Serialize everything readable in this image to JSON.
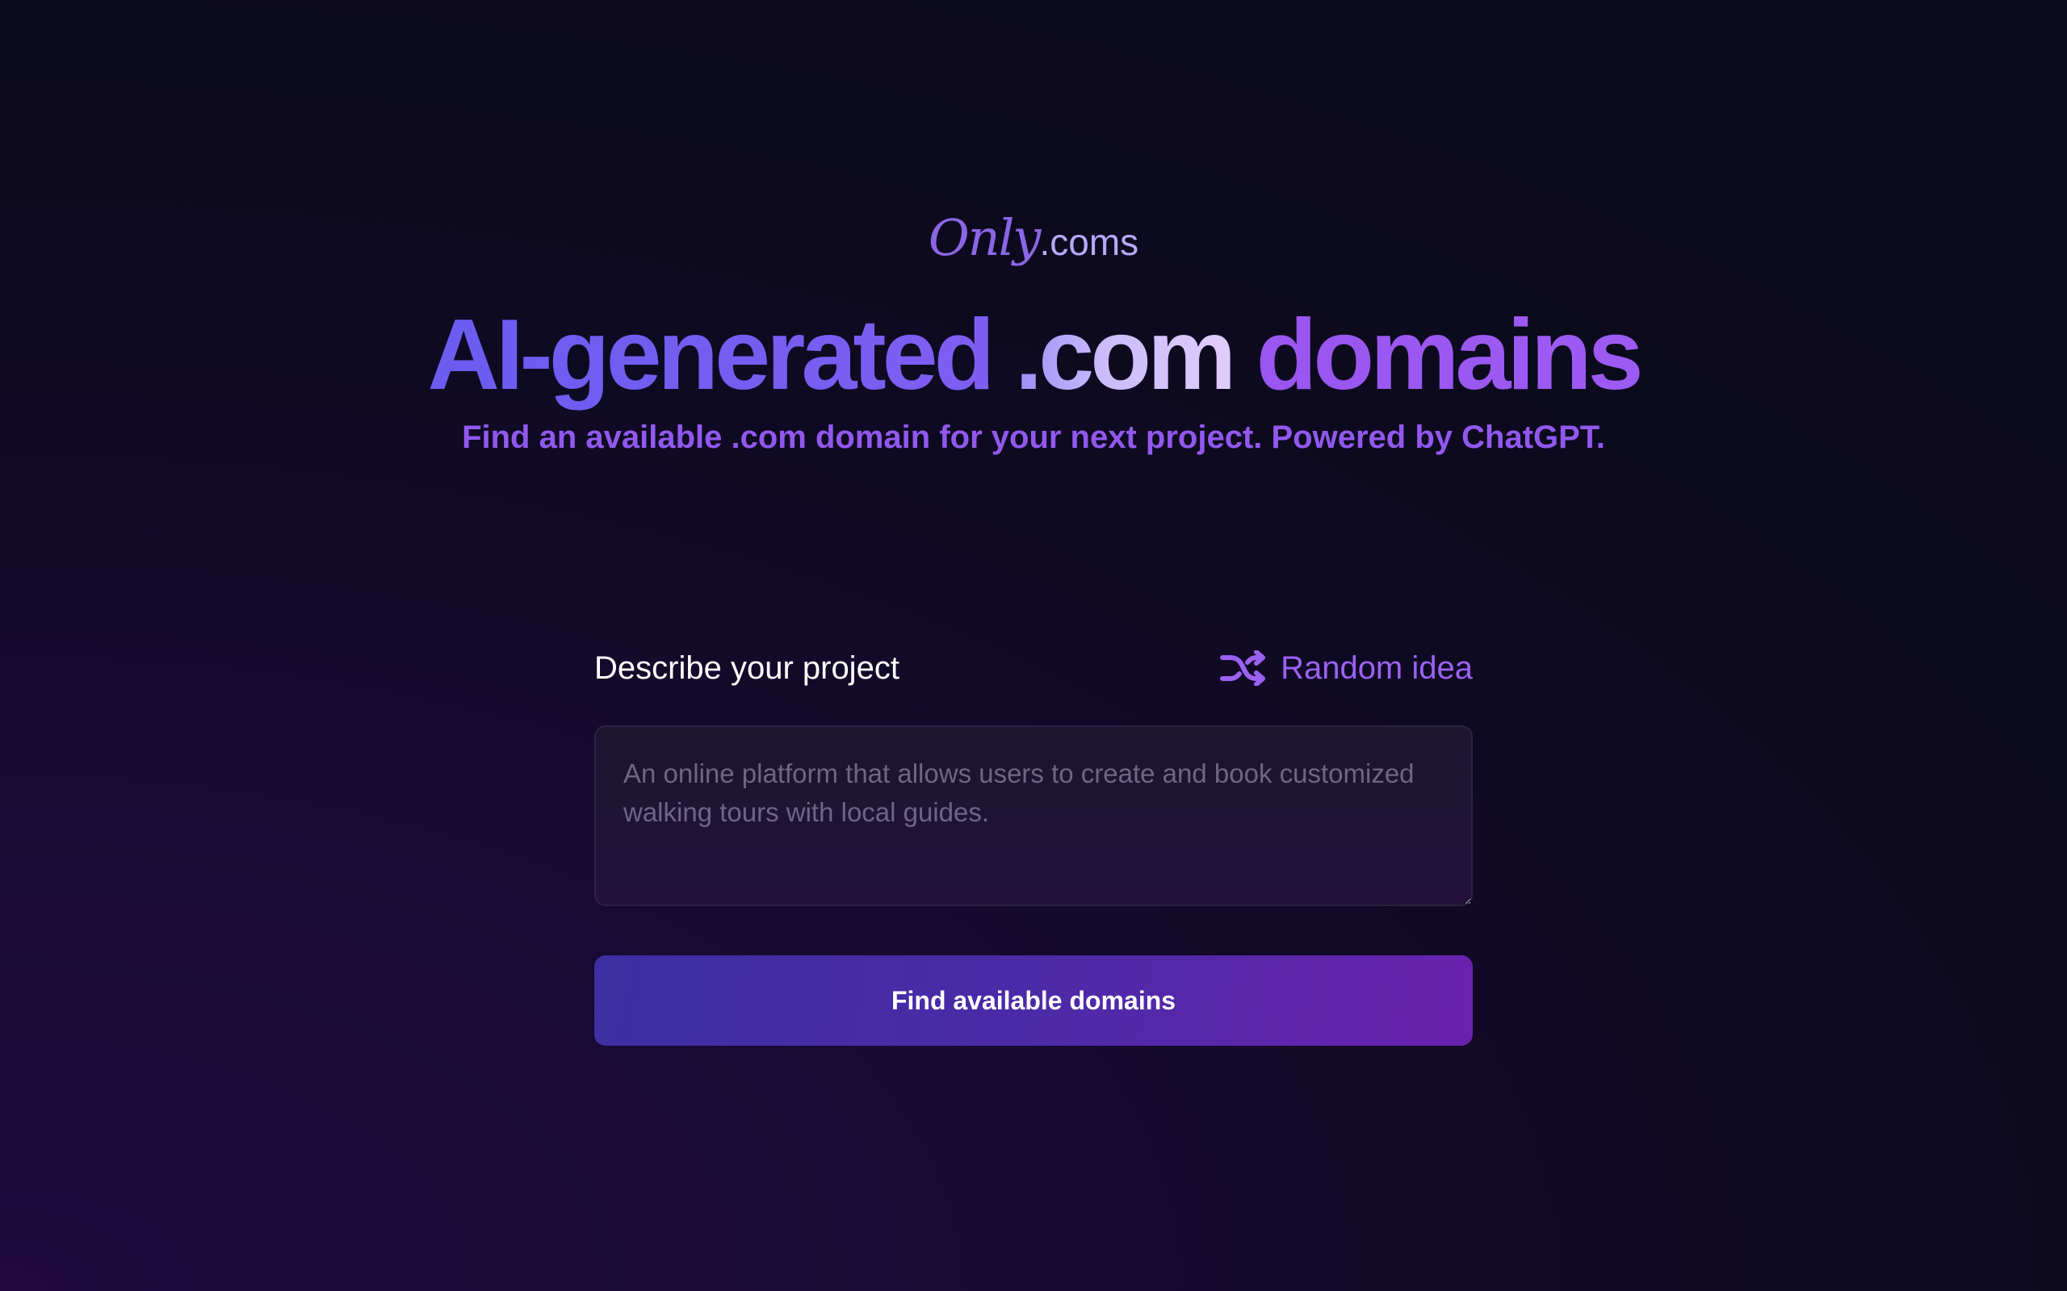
{
  "logo": {
    "only_text": "Only",
    "coms_text": ".coms"
  },
  "headline": {
    "part1": "AI-generated ",
    "part2": ".com",
    "part3": " domains"
  },
  "subtitle": "Find an available .com domain for your next project. Powered by ChatGPT.",
  "form": {
    "label": "Describe your project",
    "random_label": "Random idea",
    "random_icon": "shuffle-icon",
    "textarea_value": "",
    "textarea_placeholder": "An online platform that allows users to create and book customized walking tours with local guides.",
    "submit_label": "Find available domains"
  },
  "colors": {
    "accent": "#9b62f2",
    "button_start": "#3d2fa3",
    "button_end": "#6a22ad"
  }
}
